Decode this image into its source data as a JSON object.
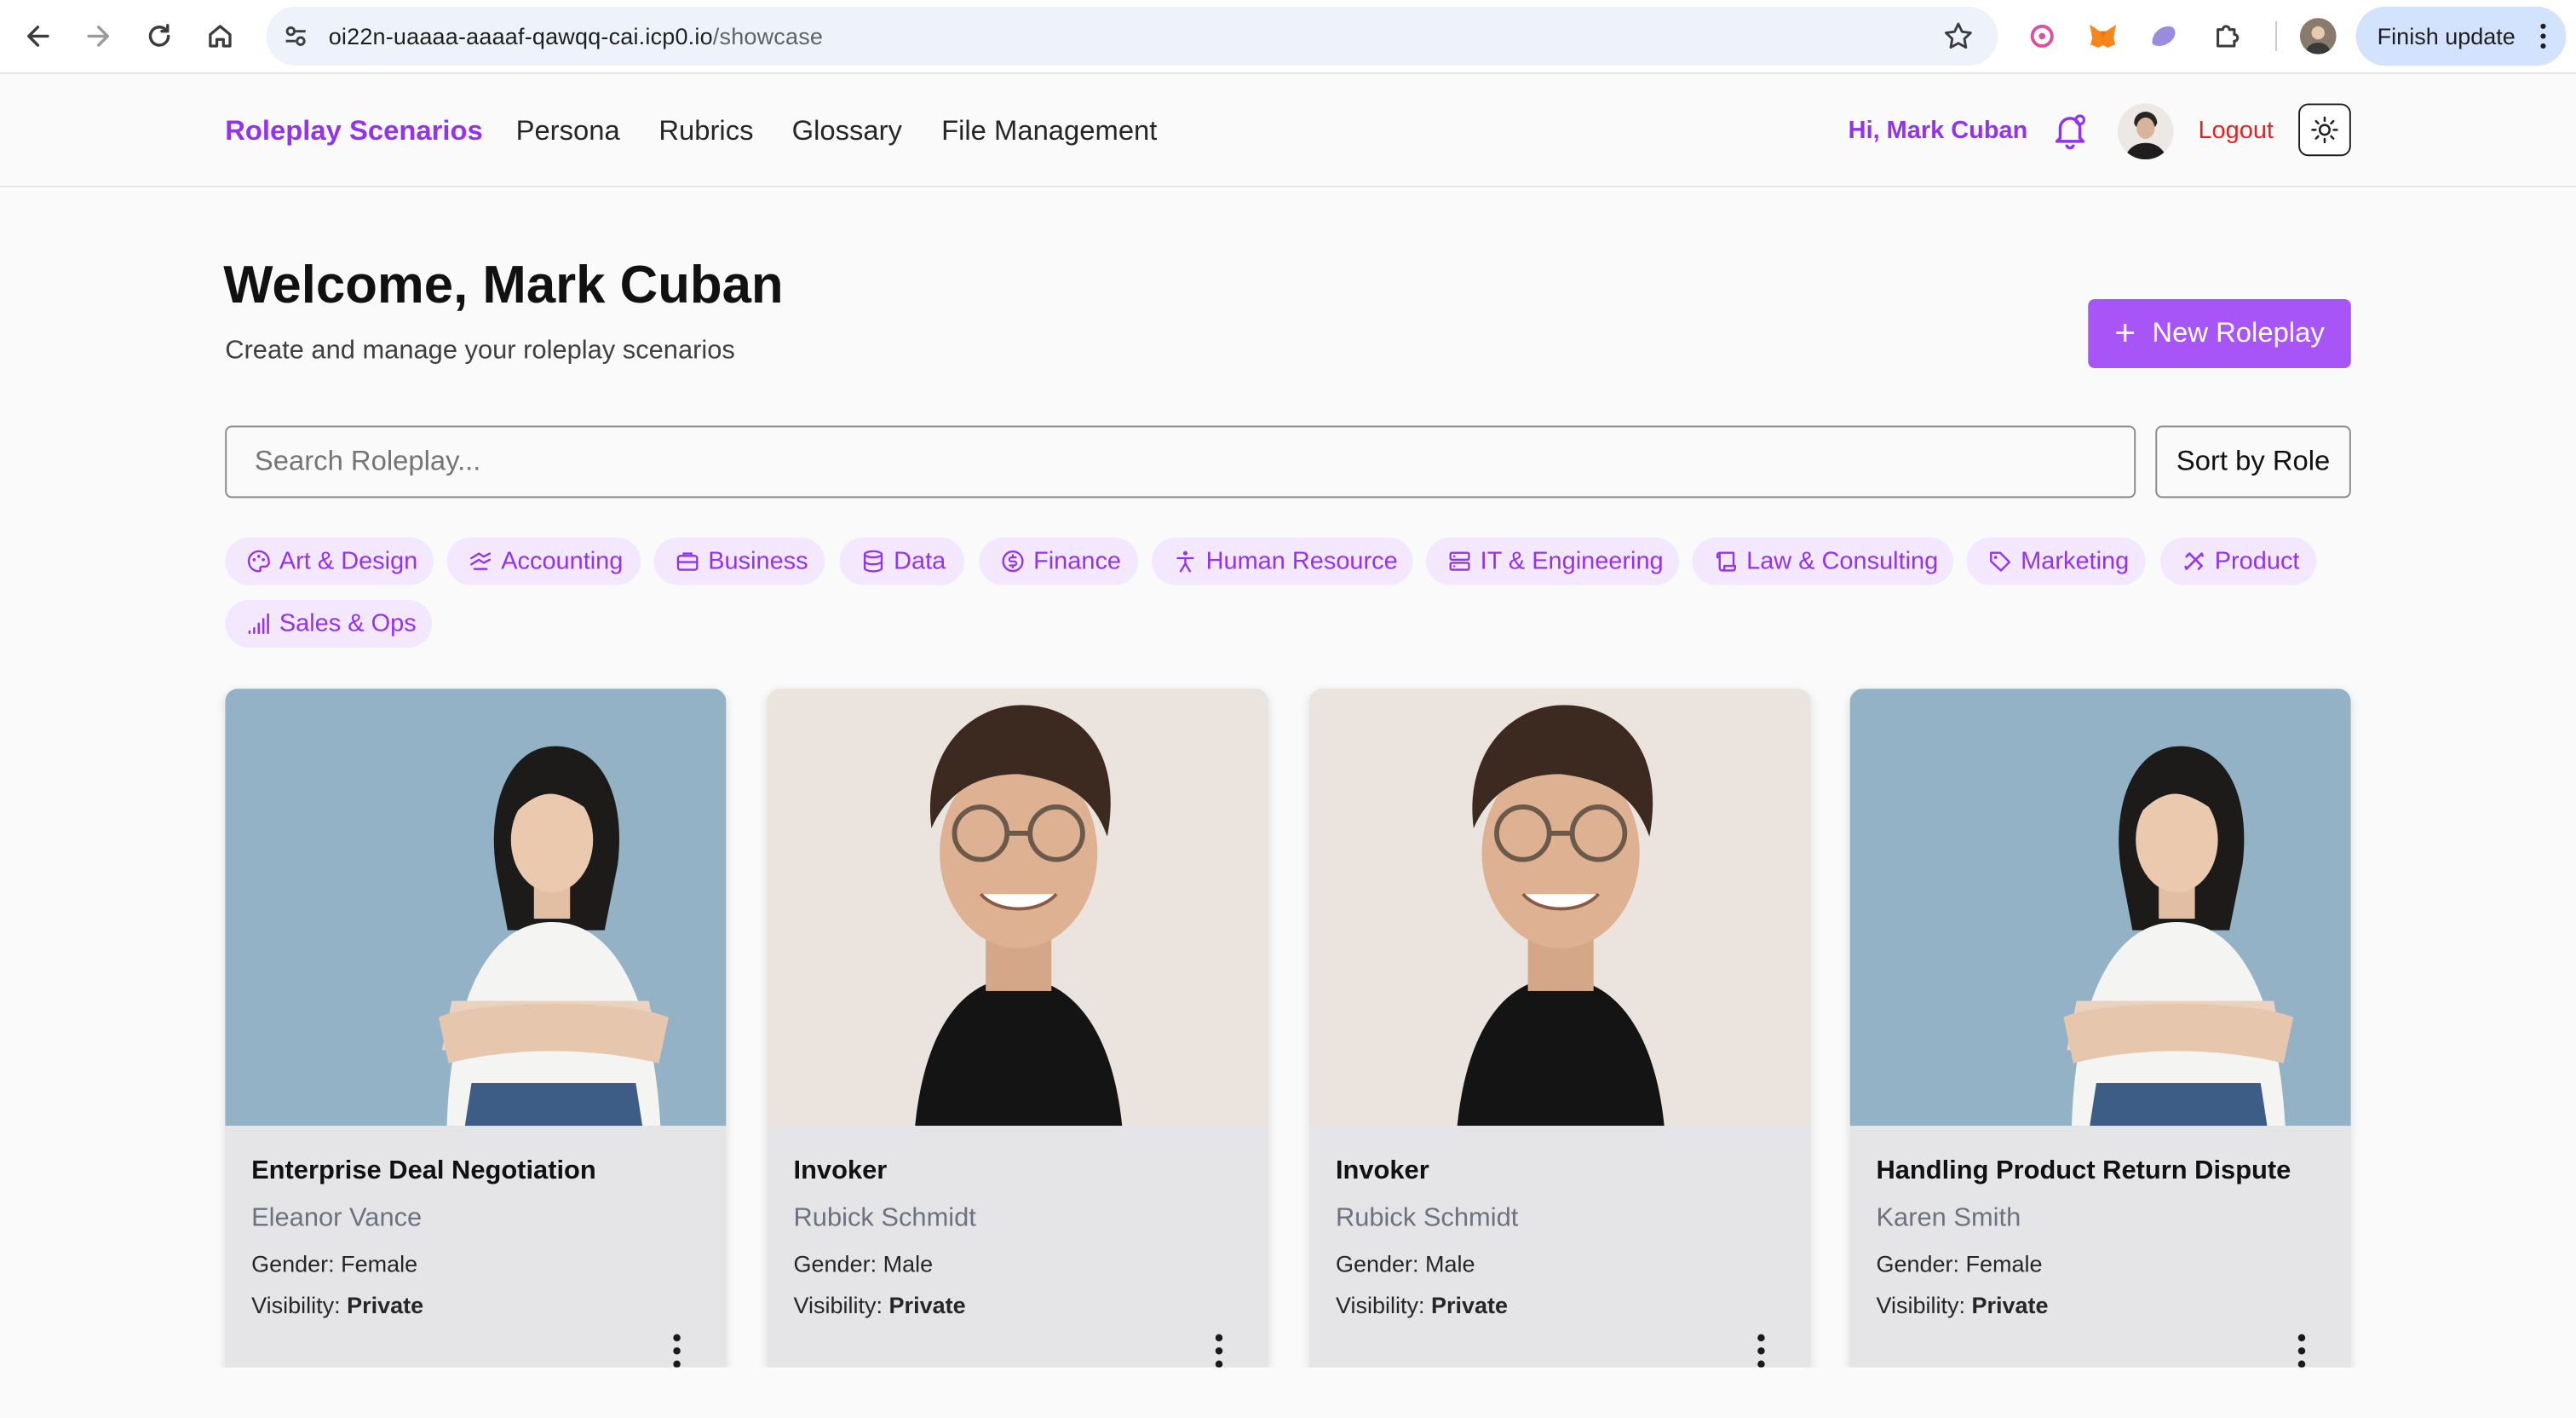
{
  "browser": {
    "url_host": "oi22n-uaaaa-aaaaf-qawqq-cai.icp0.io",
    "url_path": "/showcase",
    "finish_update_label": "Finish update"
  },
  "header": {
    "brand": "Roleplay Scenarios",
    "nav": [
      "Persona",
      "Rubrics",
      "Glossary",
      "File Management"
    ],
    "greeting": "Hi, Mark Cuban",
    "logout": "Logout"
  },
  "main": {
    "welcome": "Welcome, Mark Cuban",
    "subtitle": "Create and manage your roleplay scenarios",
    "new_button": "New Roleplay",
    "search_placeholder": "Search Roleplay...",
    "sort_label": "Sort by Role"
  },
  "categories": [
    {
      "label": "Art & Design",
      "icon": "palette-icon"
    },
    {
      "label": "Accounting",
      "icon": "accounting-icon"
    },
    {
      "label": "Business",
      "icon": "briefcase-icon"
    },
    {
      "label": "Data",
      "icon": "database-icon"
    },
    {
      "label": "Finance",
      "icon": "dollar-circle-icon"
    },
    {
      "label": "Human Resource",
      "icon": "person-icon"
    },
    {
      "label": "IT & Engineering",
      "icon": "server-icon"
    },
    {
      "label": "Law & Consulting",
      "icon": "scroll-icon"
    },
    {
      "label": "Marketing",
      "icon": "tag-icon"
    },
    {
      "label": "Product",
      "icon": "tools-icon"
    },
    {
      "label": "Sales & Ops",
      "icon": "signal-bars-icon"
    }
  ],
  "cards": [
    {
      "title": "Enterprise Deal Negotiation",
      "name": "Eleanor Vance",
      "gender_label": "Gender:",
      "gender": "Female",
      "visibility_label": "Visibility:",
      "visibility": "Private"
    },
    {
      "title": "Invoker",
      "name": "Rubick Schmidt",
      "gender_label": "Gender:",
      "gender": "Male",
      "visibility_label": "Visibility:",
      "visibility": "Private"
    },
    {
      "title": "Invoker",
      "name": "Rubick Schmidt",
      "gender_label": "Gender:",
      "gender": "Male",
      "visibility_label": "Visibility:",
      "visibility": "Private"
    },
    {
      "title": "Handling Product Return Dispute",
      "name": "Karen Smith",
      "gender_label": "Gender:",
      "gender": "Female",
      "visibility_label": "Visibility:",
      "visibility": "Private"
    }
  ],
  "colors": {
    "accent": "#9333ea",
    "accent_button": "#a855f7",
    "chip_bg": "#f3e8ff",
    "logout": "#dc2626"
  }
}
